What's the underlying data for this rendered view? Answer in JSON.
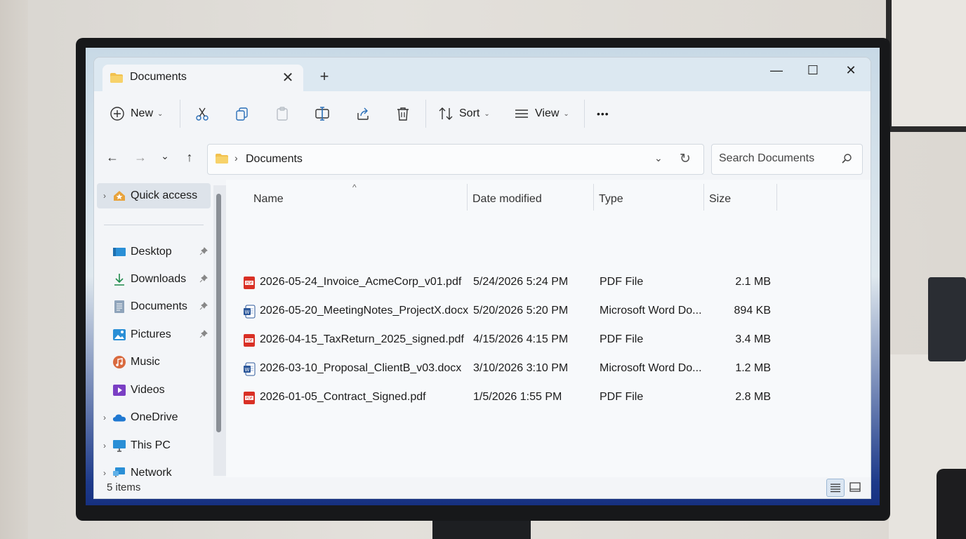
{
  "window": {
    "tab_title": "Documents",
    "tab_close": "✕",
    "new_tab": "+",
    "minimize": "—",
    "maximize": "☐",
    "close": "✕"
  },
  "toolbar": {
    "new_label": "New",
    "sort_label": "Sort",
    "view_label": "View",
    "more_label": "•••",
    "caret": "⌄"
  },
  "nav": {
    "back": "←",
    "forward": "→",
    "recent": "⌄",
    "up": "↑",
    "breadcrumb_sep": "›",
    "path": "Documents",
    "path_dropdown": "⌄",
    "refresh": "↻"
  },
  "search": {
    "placeholder": "Search Documents"
  },
  "sidebar": {
    "items": [
      {
        "label": "Quick access",
        "icon": "star-home-icon",
        "expand": "›",
        "active": true
      },
      {
        "label": "Desktop",
        "icon": "desktop-icon",
        "pinned": true
      },
      {
        "label": "Downloads",
        "icon": "download-icon",
        "pinned": true
      },
      {
        "label": "Documents",
        "icon": "document-icon",
        "pinned": true
      },
      {
        "label": "Pictures",
        "icon": "pictures-icon",
        "pinned": true
      },
      {
        "label": "Music",
        "icon": "music-icon",
        "pinned": false
      },
      {
        "label": "Videos",
        "icon": "videos-icon",
        "pinned": false
      },
      {
        "label": "OneDrive",
        "icon": "cloud-icon",
        "expand": "›"
      },
      {
        "label": "This PC",
        "icon": "monitor-icon",
        "expand": "›"
      },
      {
        "label": "Network",
        "icon": "network-icon",
        "expand": "›"
      }
    ],
    "pin_glyph": "📌"
  },
  "columns": {
    "name": "Name",
    "date": "Date modified",
    "type": "Type",
    "size": "Size",
    "sort_indicator": "^"
  },
  "files": [
    {
      "name": "2026-05-24_Invoice_AcmeCorp_v01.pdf",
      "date": "5/24/2026 5:24 PM",
      "type": "PDF File",
      "size": "2.1 MB",
      "icon": "pdf-icon"
    },
    {
      "name": "2026-05-20_MeetingNotes_ProjectX.docx",
      "date": "5/20/2026 5:20 PM",
      "type": "Microsoft Word Do...",
      "size": "894 KB",
      "icon": "word-icon"
    },
    {
      "name": "2026-04-15_TaxReturn_2025_signed.pdf",
      "date": "4/15/2026 4:15 PM",
      "type": "PDF File",
      "size": "3.4 MB",
      "icon": "pdf-icon"
    },
    {
      "name": "2026-03-10_Proposal_ClientB_v03.docx",
      "date": "3/10/2026 3:10 PM",
      "type": "Microsoft Word Do...",
      "size": "1.2 MB",
      "icon": "word-icon"
    },
    {
      "name": "2026-01-05_Contract_Signed.pdf",
      "date": "1/5/2026 1:55 PM",
      "type": "PDF File",
      "size": "2.8 MB",
      "icon": "pdf-icon"
    }
  ],
  "status": {
    "items_text": "5 items"
  },
  "colors": {
    "accent": "#0067c0",
    "folder": "#f2c14e",
    "pdf": "#d93025",
    "word": "#2b579a"
  }
}
